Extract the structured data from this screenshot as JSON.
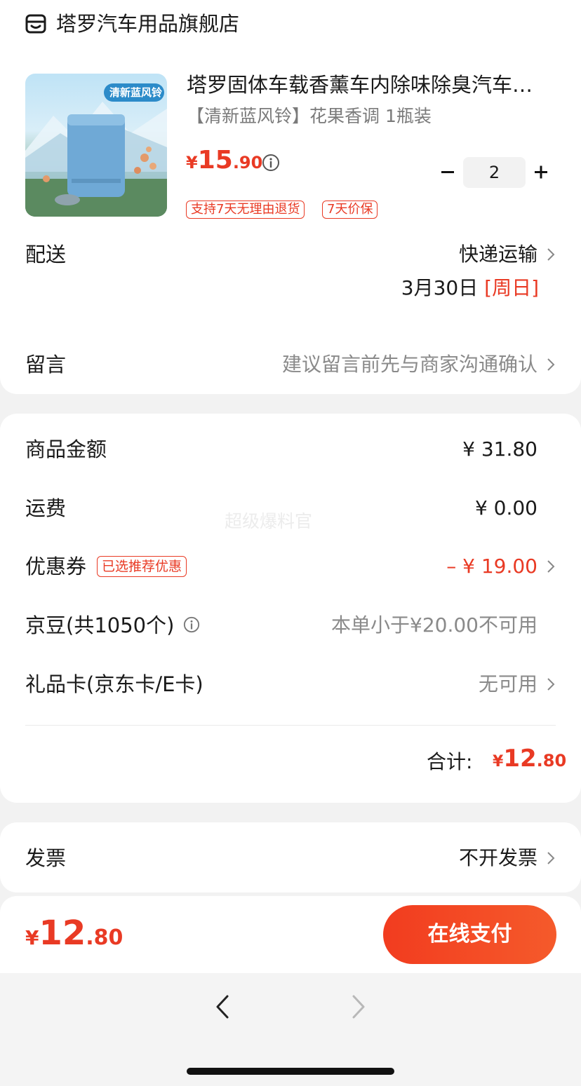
{
  "store": {
    "name": "塔罗汽车用品旗舰店",
    "icon": "store-icon"
  },
  "product": {
    "title": "塔罗固体车载香薰车内除味除臭汽车…",
    "spec": "【清新蓝风铃】花果香调 1瓶装",
    "image_badge": "清新蓝风铃",
    "price_symbol": "¥",
    "price_int": "15",
    "price_dec": ".90",
    "quantity": "2",
    "tags": [
      "支持7天无理由退货",
      "7天价保"
    ]
  },
  "delivery": {
    "label": "配送",
    "method": "快递运输",
    "date": "3月30日",
    "weekday": "[周日]"
  },
  "message": {
    "label": "留言",
    "placeholder": "建议留言前先与商家沟通确认"
  },
  "summary": {
    "goods_label": "商品金额",
    "goods_value": "¥ 31.80",
    "shipping_label": "运费",
    "shipping_value": "¥ 0.00",
    "coupon_label": "优惠券",
    "coupon_tag": "已选推荐优惠",
    "coupon_value": "– ¥ 19.00",
    "beans_label": "京豆(共1050个)",
    "beans_value": "本单小于¥20.00不可用",
    "giftcard_label": "礼品卡(京东卡/E卡)",
    "giftcard_value": "无可用",
    "total_label": "合计:",
    "total_symbol": "¥",
    "total_int": "12",
    "total_dec": ".80"
  },
  "invoice": {
    "label": "发票",
    "value": "不开发票"
  },
  "footer": {
    "symbol": "¥",
    "total_int": "12",
    "total_dec": ".80",
    "pay_label": "在线支付"
  },
  "watermark": "超级爆料官",
  "colors": {
    "accent": "#e93a24",
    "pay_button": "#f23c1f"
  }
}
